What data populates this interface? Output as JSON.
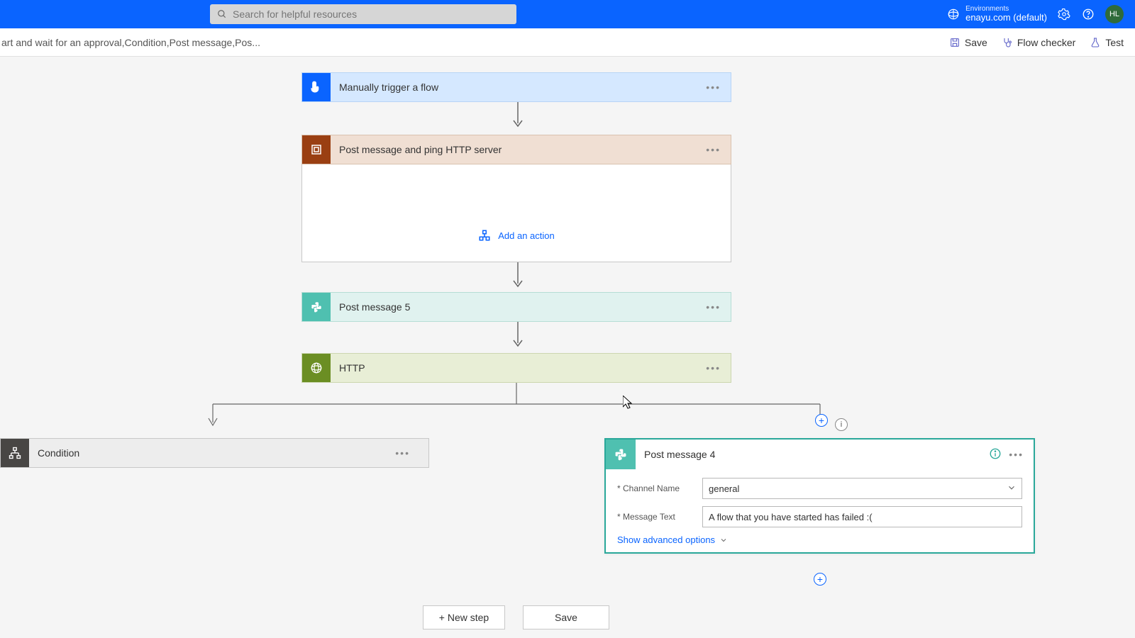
{
  "topbar": {
    "search_placeholder": "Search for helpful resources",
    "env_label": "Environments",
    "env_name": "enayu.com (default)",
    "avatar_initials": "HL"
  },
  "cmdbar": {
    "breadcrumb": "art and wait for an approval,Condition,Post message,Pos...",
    "save": "Save",
    "flow_checker": "Flow checker",
    "test": "Test"
  },
  "cards": {
    "trigger": {
      "title": "Manually trigger a flow"
    },
    "scope": {
      "title": "Post message and ping HTTP server"
    },
    "add_action": "Add an action",
    "postmsg5": {
      "title": "Post message 5"
    },
    "http": {
      "title": "HTTP"
    },
    "condition": {
      "title": "Condition"
    },
    "postmsg4": {
      "title": "Post message 4",
      "channel_label": "Channel Name",
      "channel_value": "general",
      "message_label": "Message Text",
      "message_value": "A flow that you have started has failed :(",
      "advanced": "Show advanced options"
    }
  },
  "bottom": {
    "new_step": "+ New step",
    "save": "Save"
  }
}
